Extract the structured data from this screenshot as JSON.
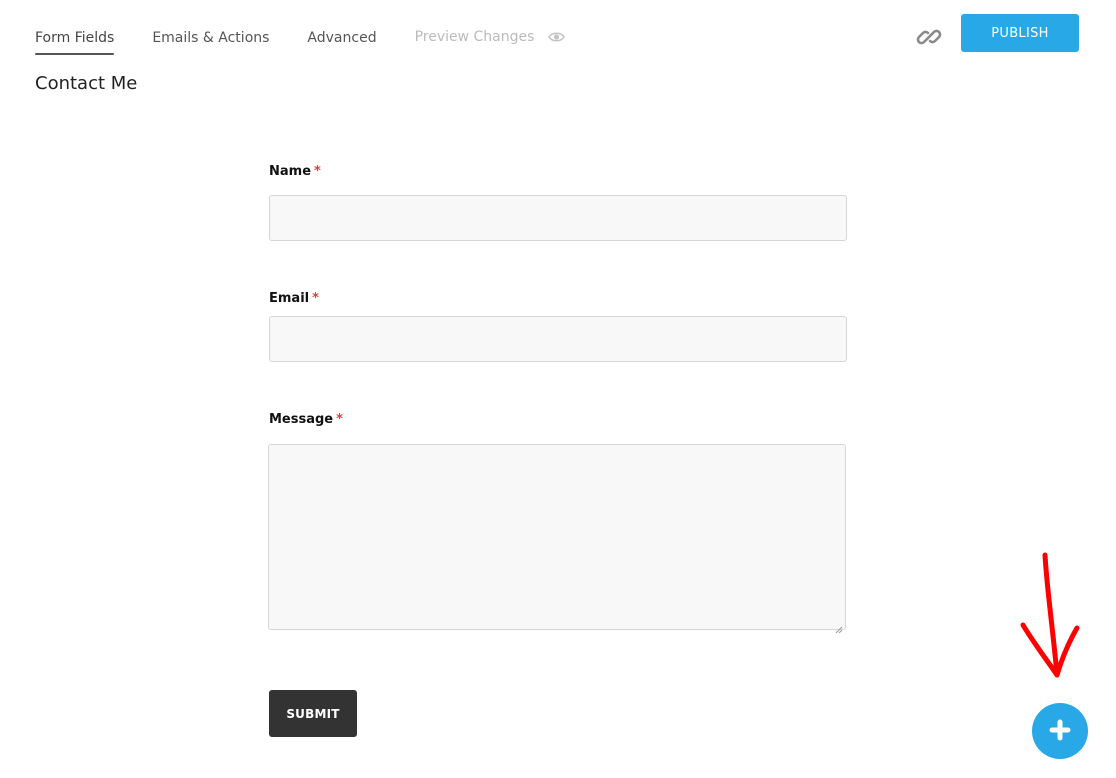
{
  "tabs": [
    {
      "label": "Form Fields",
      "active": true
    },
    {
      "label": "Emails & Actions",
      "active": false
    },
    {
      "label": "Advanced",
      "active": false
    },
    {
      "label": "Preview Changes",
      "active": false,
      "disabled": true,
      "icon": "eye-icon"
    }
  ],
  "toolbar": {
    "link_icon": "link-icon",
    "publish_label": "PUBLISH"
  },
  "form": {
    "title": "Contact Me",
    "fields": [
      {
        "label": "Name",
        "required_marker": "*",
        "type": "text",
        "value": ""
      },
      {
        "label": "Email",
        "required_marker": "*",
        "type": "email",
        "value": ""
      },
      {
        "label": "Message",
        "required_marker": "*",
        "type": "textarea",
        "value": ""
      }
    ],
    "submit_label": "SUBMIT"
  },
  "add_button": {
    "icon": "plus-icon"
  },
  "annotation": {
    "type": "hand-drawn-arrow",
    "color": "#ff0000"
  },
  "colors": {
    "accent": "#29a8e8",
    "submit_bg": "#333333",
    "required": "#e53935"
  }
}
